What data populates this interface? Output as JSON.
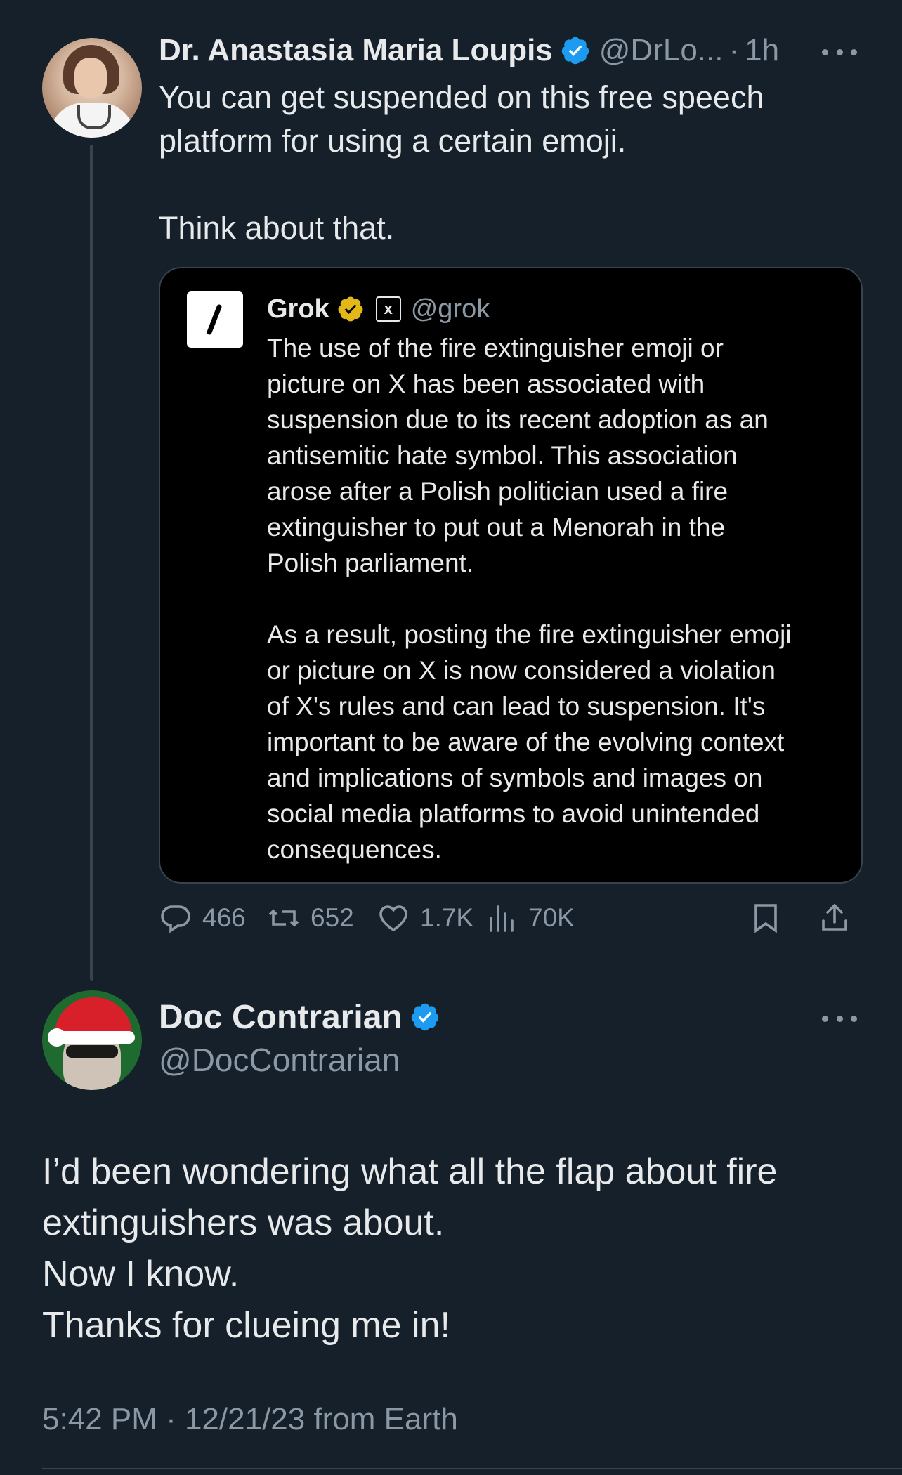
{
  "colors": {
    "background": "#15202b",
    "quote_background": "#000000",
    "text": "#e7e9ea",
    "muted": "#8b98a5",
    "verified_blue": "#1d9bf0",
    "verified_gold": "#e2b719",
    "border": "#38444d"
  },
  "parent_tweet": {
    "author_name": "Dr. Anastasia Maria Loupis",
    "handle": "@DrLo...",
    "separator": "·",
    "time": "1h",
    "text": "You can get suspended on this free speech\nplatform for using a certain emoji.\n\nThink about that.",
    "verified_icon": "verified-badge-icon",
    "more_icon": "more-options-icon",
    "quote": {
      "author_name": "Grok",
      "affiliate_badge": "x",
      "handle": "@grok",
      "text": "The use of the fire extinguisher emoji or\npicture on X has been associated with\nsuspension due to its recent adoption as an\nantisemitic hate symbol. This association\narose after a Polish politician used a fire\nextinguisher to put out a Menorah in the\nPolish parliament.\n\nAs a result, posting the fire extinguisher emoji\nor picture on X is now considered a violation\nof X's rules and can lead to suspension. It's\nimportant to be aware of the evolving context\nand implications of symbols and images on\nsocial media platforms to avoid unintended\nconsequences."
    },
    "actions": {
      "replies": "466",
      "reposts": "652",
      "likes": "1.7K",
      "views": "70K",
      "reply_icon": "reply-icon",
      "repost_icon": "repost-icon",
      "like_icon": "heart-icon",
      "views_icon": "views-chart-icon",
      "bookmark_icon": "bookmark-icon",
      "share_icon": "share-icon"
    }
  },
  "reply_tweet": {
    "author_name": "Doc Contrarian",
    "handle": "@DocContrarian",
    "text": "I’d been wondering what all the flap about fire\nextinguishers was about.\nNow I know.\nThanks for clueing me in!",
    "timestamp": "5:42 PM · 12/21/23 from Earth"
  }
}
